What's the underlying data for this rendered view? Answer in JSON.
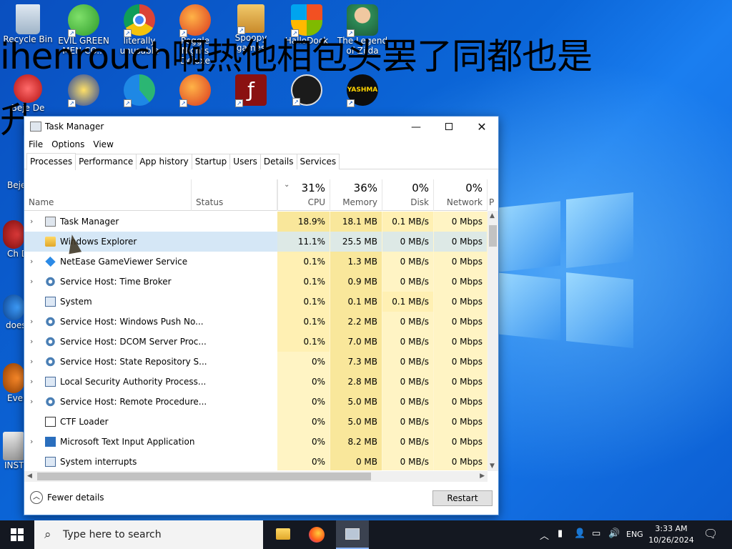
{
  "desktop": {
    "icons": [
      {
        "label": "Recycle Bin",
        "icon": "recycle-bin-icon"
      },
      {
        "label": "EVIL GREEN MEN CO...",
        "icon": "green-men-icon"
      },
      {
        "label": "literally unusable",
        "icon": "chrome-icon"
      },
      {
        "label": "Peggle Nights Deluxe",
        "icon": "peggle-icon"
      },
      {
        "label": "Spoopy games",
        "icon": "folder-icon"
      },
      {
        "label": "HalloDock",
        "icon": "windows-shield-icon"
      },
      {
        "label": "The Legend of Zilda",
        "icon": "zelda-icon"
      },
      {
        "label": "Beje De",
        "icon": "bejeweled-icon"
      },
      {
        "label": "Beje De",
        "icon": "bejeweled-icon"
      },
      {
        "label": "Ch De",
        "icon": "chuzzle-icon"
      },
      {
        "label": "does",
        "icon": "app-icon"
      },
      {
        "label": "Ever",
        "icon": "app-icon"
      },
      {
        "label": "INST",
        "icon": "installer-icon"
      }
    ],
    "overlay_text_line1": "ihenrouch啊热他相包头罢了同都也是",
    "overlay_text_line2": "升"
  },
  "window": {
    "title": "Task Manager",
    "menu": [
      "File",
      "Options",
      "View"
    ],
    "tabs": [
      "Processes",
      "Performance",
      "App history",
      "Startup",
      "Users",
      "Details",
      "Services"
    ],
    "active_tab": "Processes"
  },
  "columns": {
    "name": "Name",
    "status": "Status",
    "cpu": {
      "pct": "31%",
      "label": "CPU"
    },
    "memory": {
      "pct": "36%",
      "label": "Memory"
    },
    "disk": {
      "pct": "0%",
      "label": "Disk"
    },
    "network": {
      "pct": "0%",
      "label": "Network"
    },
    "power_partial": "P"
  },
  "processes": [
    {
      "name": "Task Manager",
      "expand": true,
      "cpu": "18.9%",
      "mem": "18.1 MB",
      "disk": "0.1 MB/s",
      "net": "0 Mbps",
      "icon": "task-manager-icon"
    },
    {
      "name": "Windows Explorer",
      "expand": false,
      "selected": true,
      "cpu": "11.1%",
      "mem": "25.5 MB",
      "disk": "0 MB/s",
      "net": "0 Mbps",
      "icon": "explorer-folder-icon"
    },
    {
      "name": "NetEase GameViewer Service",
      "expand": true,
      "cpu": "0.1%",
      "mem": "1.3 MB",
      "disk": "0 MB/s",
      "net": "0 Mbps",
      "icon": "netease-icon"
    },
    {
      "name": "Service Host: Time Broker",
      "expand": true,
      "cpu": "0.1%",
      "mem": "0.9 MB",
      "disk": "0 MB/s",
      "net": "0 Mbps",
      "icon": "gear-icon"
    },
    {
      "name": "System",
      "expand": false,
      "cpu": "0.1%",
      "mem": "0.1 MB",
      "disk": "0.1 MB/s",
      "net": "0 Mbps",
      "icon": "system-icon"
    },
    {
      "name": "Service Host: Windows Push No...",
      "expand": true,
      "cpu": "0.1%",
      "mem": "2.2 MB",
      "disk": "0 MB/s",
      "net": "0 Mbps",
      "icon": "gear-icon"
    },
    {
      "name": "Service Host: DCOM Server Proc...",
      "expand": true,
      "cpu": "0.1%",
      "mem": "7.0 MB",
      "disk": "0 MB/s",
      "net": "0 Mbps",
      "icon": "gear-icon"
    },
    {
      "name": "Service Host: State Repository S...",
      "expand": true,
      "cpu": "0%",
      "mem": "7.3 MB",
      "disk": "0 MB/s",
      "net": "0 Mbps",
      "icon": "gear-icon"
    },
    {
      "name": "Local Security Authority Process...",
      "expand": true,
      "cpu": "0%",
      "mem": "2.8 MB",
      "disk": "0 MB/s",
      "net": "0 Mbps",
      "icon": "system-icon"
    },
    {
      "name": "Service Host: Remote Procedure...",
      "expand": true,
      "cpu": "0%",
      "mem": "5.0 MB",
      "disk": "0 MB/s",
      "net": "0 Mbps",
      "icon": "gear-icon"
    },
    {
      "name": "CTF Loader",
      "expand": false,
      "cpu": "0%",
      "mem": "5.0 MB",
      "disk": "0 MB/s",
      "net": "0 Mbps",
      "icon": "pen-icon"
    },
    {
      "name": "Microsoft Text Input Application",
      "expand": true,
      "cpu": "0%",
      "mem": "8.2 MB",
      "disk": "0 MB/s",
      "net": "0 Mbps",
      "icon": "text-input-icon"
    },
    {
      "name": "System interrupts",
      "expand": false,
      "cpu": "0%",
      "mem": "0 MB",
      "disk": "0 MB/s",
      "net": "0 Mbps",
      "icon": "system-icon"
    }
  ],
  "footer": {
    "fewer_details": "Fewer details",
    "restart": "Restart"
  },
  "taskbar": {
    "search_placeholder": "Type here to search",
    "language": "ENG",
    "time": "3:33 AM",
    "date": "10/26/2024"
  },
  "colors": {
    "heat_high": "#f9e79b",
    "heat_mid": "#fff0b3",
    "heat_low": "#fff4c4",
    "selected_row": "#d5e7f6",
    "taskbar": "#141821"
  }
}
